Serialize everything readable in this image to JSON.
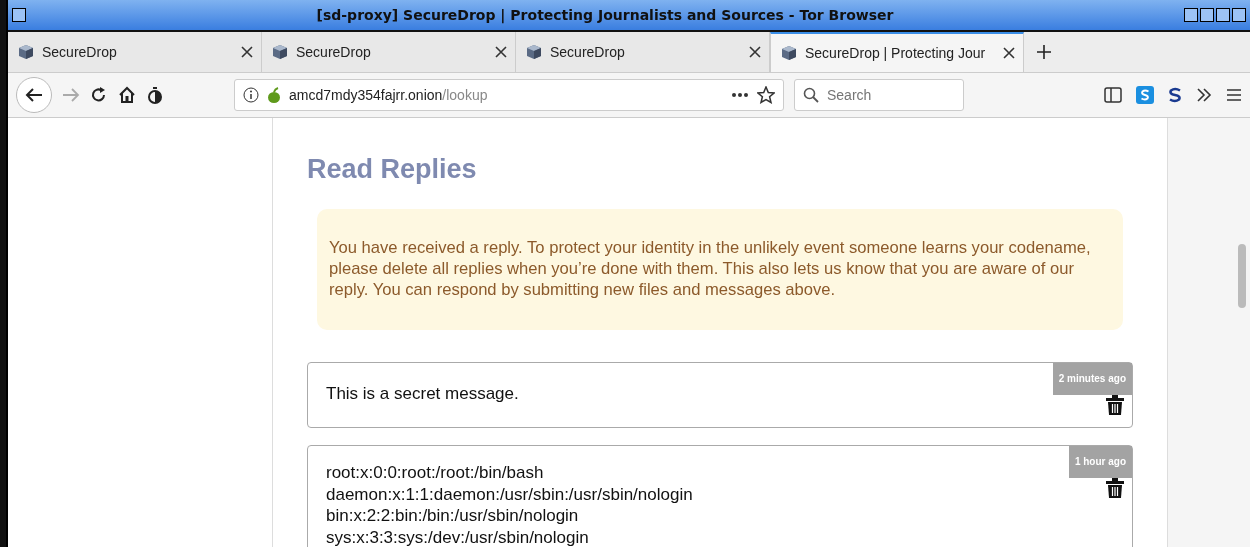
{
  "window": {
    "title": "[sd-proxy] SecureDrop | Protecting Journalists and Sources - Tor Browser"
  },
  "tabs": [
    {
      "label": "SecureDrop",
      "selected": false
    },
    {
      "label": "SecureDrop",
      "selected": false
    },
    {
      "label": "SecureDrop",
      "selected": false
    },
    {
      "label": "SecureDrop | Protecting Jour",
      "selected": true
    }
  ],
  "address_bar": {
    "host": "amcd7mdy354fajrr.onion",
    "path": "/lookup"
  },
  "search": {
    "placeholder": "Search"
  },
  "page": {
    "heading": "Read Replies",
    "notice": "You have received a reply. To protect your identity in the unlikely event someone learns your codename, please delete all replies when you’re done with them. This also lets us know that you are aware of our reply. You can respond by submitting new files and messages above.",
    "replies": [
      {
        "time": "2 minutes ago",
        "lines": [
          "This is a secret message."
        ]
      },
      {
        "time": "1 hour ago",
        "lines": [
          "root:x:0:0:root:/root:/bin/bash",
          "daemon:x:1:1:daemon:/usr/sbin:/usr/sbin/nologin",
          "bin:x:2:2:bin:/bin:/usr/sbin/nologin",
          "sys:x:3:3:sys:/dev:/usr/sbin/nologin"
        ]
      }
    ]
  }
}
